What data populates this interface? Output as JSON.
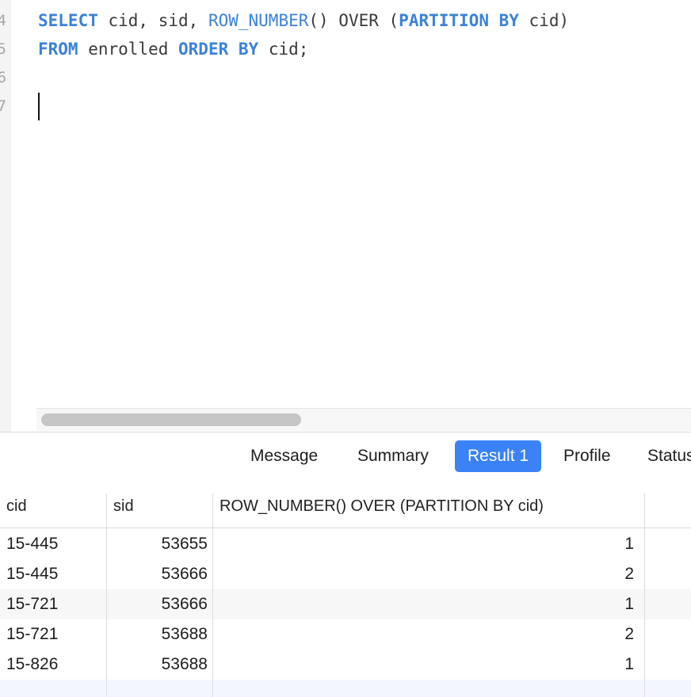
{
  "editor": {
    "line_numbers": [
      "4",
      "5",
      "6",
      "7"
    ],
    "lines": [
      [
        {
          "t": "SELECT",
          "c": "kw"
        },
        {
          "t": " cid, sid, ",
          "c": ""
        },
        {
          "t": "ROW_NUMBER",
          "c": "fn"
        },
        {
          "t": "() OVER (",
          "c": ""
        },
        {
          "t": "PARTITION BY",
          "c": "kw"
        },
        {
          "t": " cid)",
          "c": ""
        }
      ],
      [
        {
          "t": "FROM",
          "c": "kw"
        },
        {
          "t": " enrolled ",
          "c": ""
        },
        {
          "t": "ORDER BY",
          "c": "kw"
        },
        {
          "t": " cid;",
          "c": ""
        }
      ]
    ]
  },
  "tabs": [
    {
      "label": "Message",
      "active": false
    },
    {
      "label": "Summary",
      "active": false
    },
    {
      "label": "Result 1",
      "active": true
    },
    {
      "label": "Profile",
      "active": false
    },
    {
      "label": "Status",
      "active": false
    }
  ],
  "results": {
    "columns": [
      "cid",
      "sid",
      "ROW_NUMBER() OVER (PARTITION BY cid)"
    ],
    "rows": [
      [
        "15-445",
        "53655",
        "1"
      ],
      [
        "15-445",
        "53666",
        "2"
      ],
      [
        "15-721",
        "53666",
        "1"
      ],
      [
        "15-721",
        "53688",
        "2"
      ],
      [
        "15-826",
        "53688",
        "1"
      ]
    ]
  }
}
